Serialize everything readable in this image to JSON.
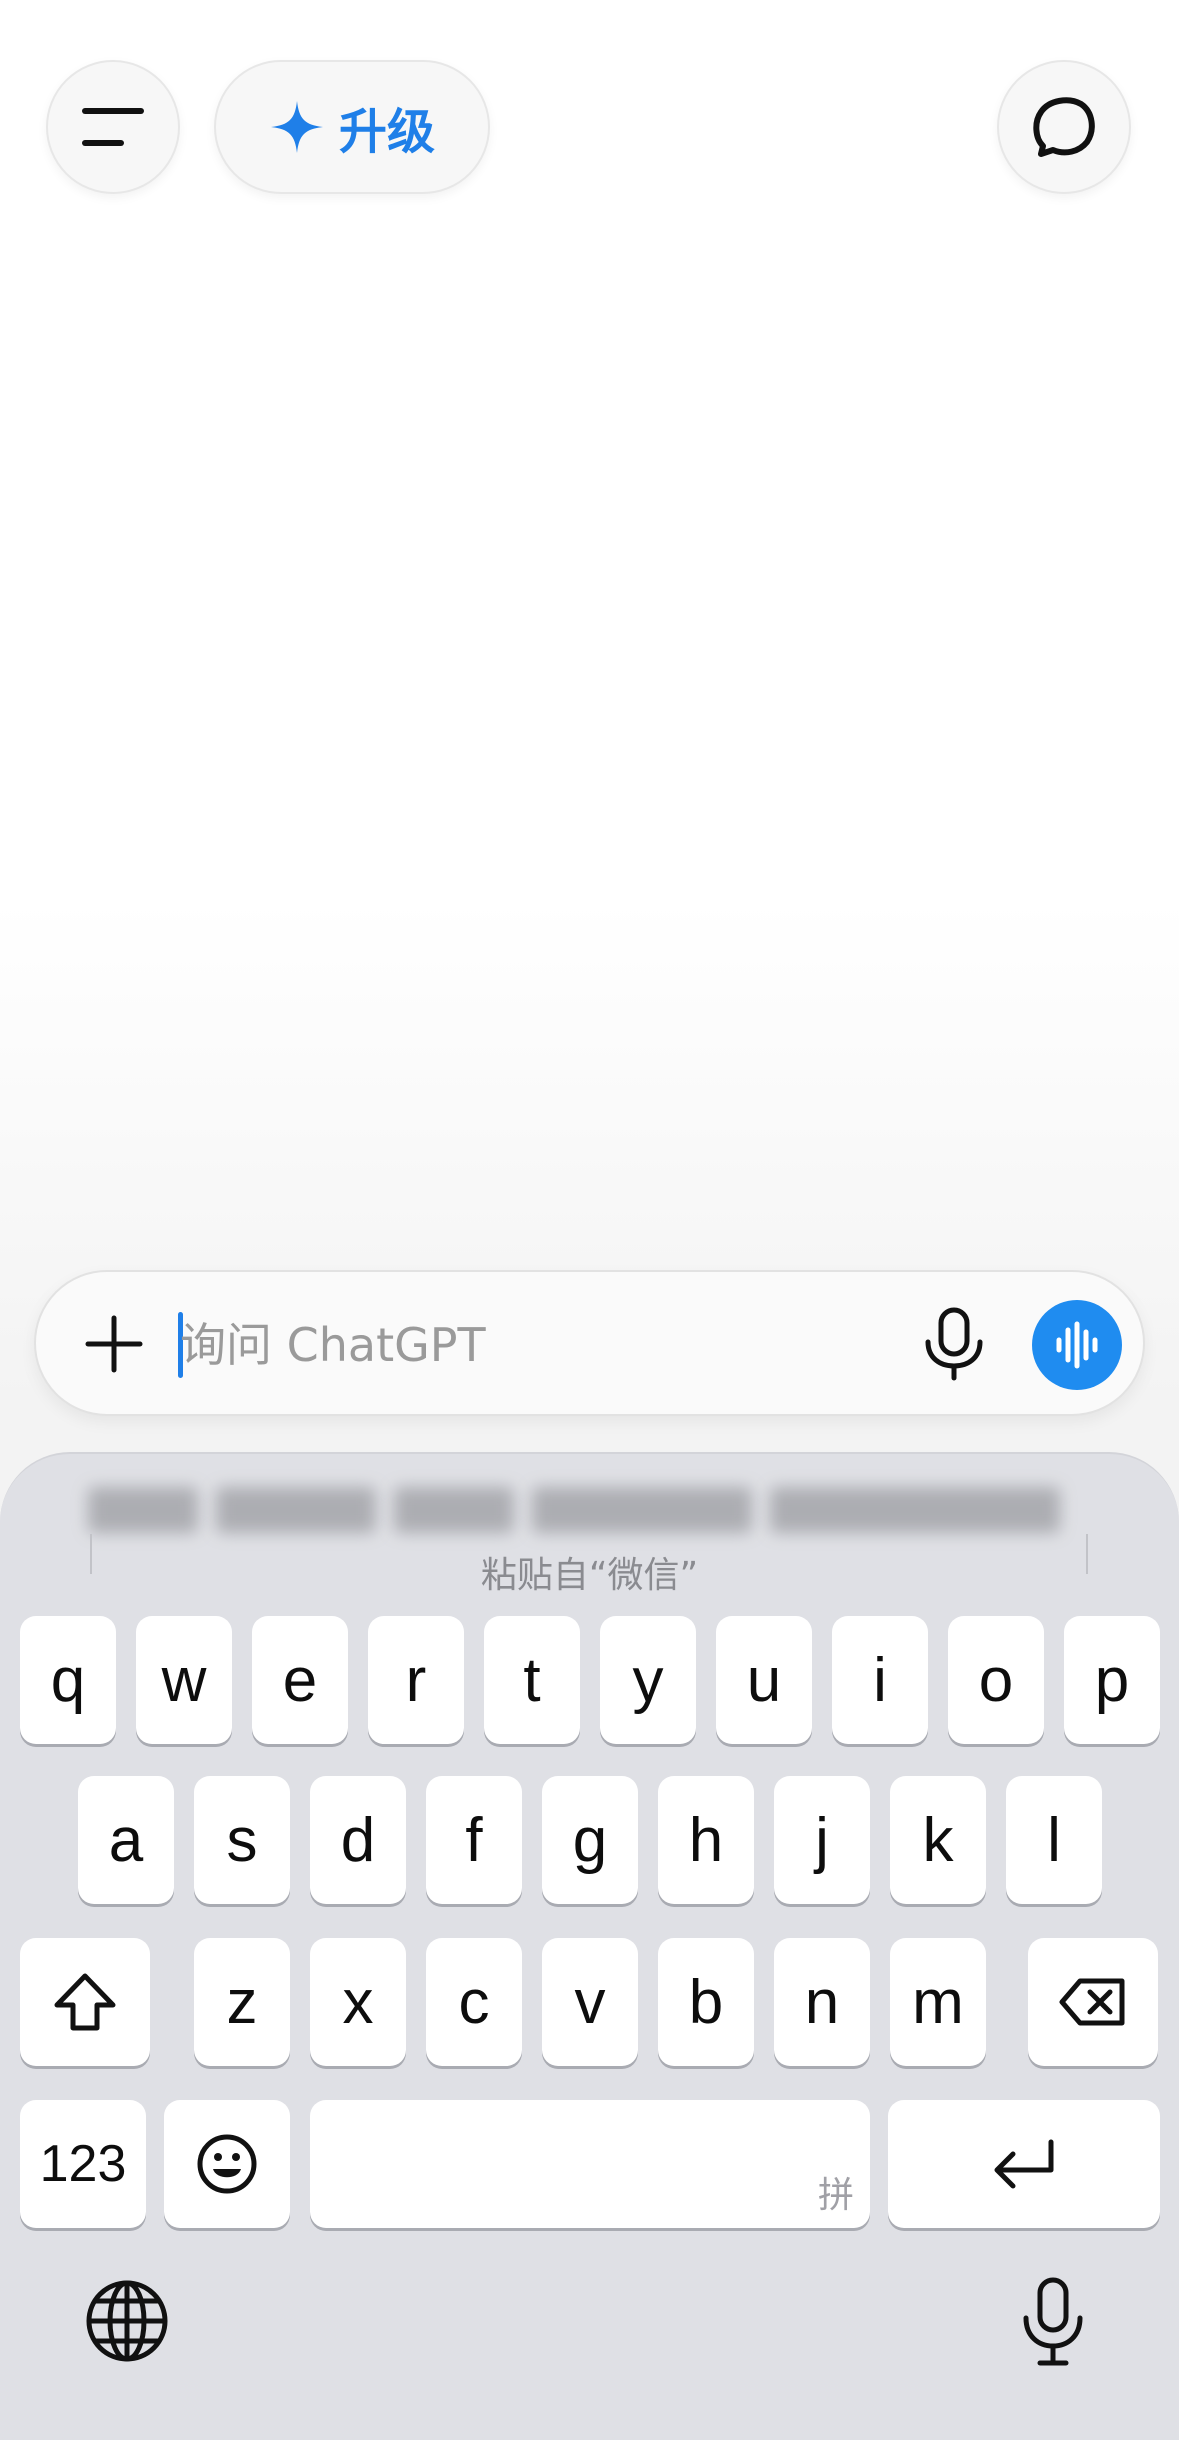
{
  "header": {
    "menu_icon": "hamburger-menu-icon",
    "upgrade_label": "升级",
    "upgrade_icon": "sparkle-icon",
    "new_chat_icon": "new-chat-bubble-icon",
    "accent_color": "#1f7fe8"
  },
  "composer": {
    "placeholder": "询问 ChatGPT",
    "value": "",
    "add_icon": "plus-icon",
    "dictate_icon": "microphone-icon",
    "voice_mode_icon": "voice-waveform-icon",
    "voice_color": "#1f8cf0"
  },
  "keyboard": {
    "suggestion_caption": "粘贴自“微信”",
    "rows": [
      [
        "q",
        "w",
        "e",
        "r",
        "t",
        "y",
        "u",
        "i",
        "o",
        "p"
      ],
      [
        "a",
        "s",
        "d",
        "f",
        "g",
        "h",
        "j",
        "k",
        "l"
      ],
      [
        "z",
        "x",
        "c",
        "v",
        "b",
        "n",
        "m"
      ]
    ],
    "shift_icon": "shift-icon",
    "delete_icon": "backspace-icon",
    "numbers_label": "123",
    "emoji_icon": "emoji-icon",
    "space_hint": "拼",
    "return_icon": "return-icon",
    "globe_icon": "globe-icon",
    "dictation_icon": "microphone-icon",
    "background_color": "#dfe0e5"
  }
}
